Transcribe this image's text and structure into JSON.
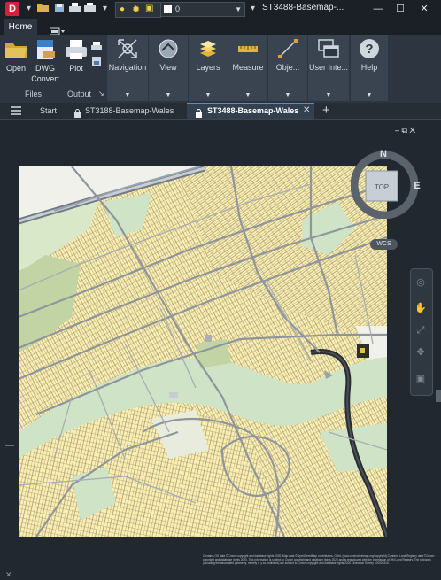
{
  "app": {
    "logo_letter": "D",
    "title": "ST3488-Basemap-..."
  },
  "quick_access": {
    "layer_value": "0"
  },
  "window_controls": {
    "minimize": "—",
    "restore": "☐",
    "close": "✕"
  },
  "ribbon": {
    "tabs": [
      {
        "label": "Home"
      }
    ],
    "buttons": {
      "open": "Open",
      "dwg_convert_line1": "DWG",
      "dwg_convert_line2": "Convert",
      "plot": "Plot"
    },
    "panel_labels": {
      "files": "Files",
      "output": "Output"
    },
    "groups": [
      "Navigation",
      "View",
      "Layers",
      "Measure",
      "Obje...",
      "User Inte...",
      "Help"
    ]
  },
  "doc_tabs": {
    "start": "Start",
    "tab1": "ST3188-Basemap-Wales",
    "tab2": "ST3488-Basemap-Wales",
    "new": "+"
  },
  "viewport": {
    "controls": "– ⧉ ✕"
  },
  "navcube": {
    "north": "N",
    "east": "E",
    "face": "TOP",
    "wcs": "WCS"
  },
  "copyright": "Contains OS data ©Crown copyright and database rights 2020. Map data ©OpenStreetMap contributors, ODbL (www.openstreetmap.org/copyright) Contains Land Registry data ©Crown copyright and database rights 2020. This information is subject to Crown copyright and database rights 2020 and is reproduced with the permission of HM Land Registry. The polygons (including the associated geometry, namely x, y co-ordinates) are subject to Crown copyright and database rights 2020 Ordnance Survey 100026316."
}
